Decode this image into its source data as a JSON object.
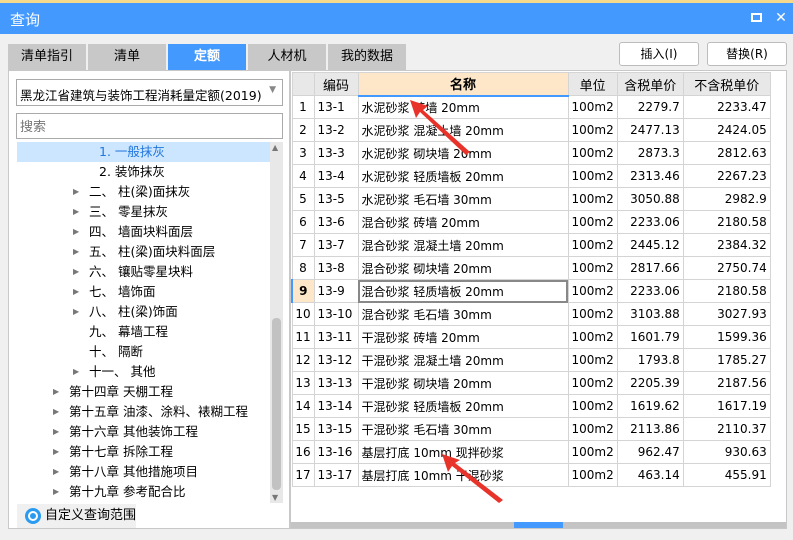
{
  "window": {
    "title": "查询",
    "maximize_icon": "maximize-icon",
    "close_icon": "close-icon"
  },
  "tabs": [
    {
      "label": "清单指引"
    },
    {
      "label": "清单"
    },
    {
      "label": "定额",
      "active": true
    },
    {
      "label": "人材机"
    },
    {
      "label": "我的数据"
    }
  ],
  "buttons": {
    "insert": "插入(I)",
    "replace": "替换(R)"
  },
  "left": {
    "dropdown_value": "黑龙江省建筑与装饰工程消耗量定额(2019)",
    "search_placeholder": "搜索",
    "tree": [
      {
        "label": "1. 一般抹灰",
        "level": 3,
        "selected": true,
        "expandable": false
      },
      {
        "label": "2. 装饰抹灰",
        "level": 3,
        "expandable": false
      },
      {
        "label": "二、 柱(梁)面抹灰",
        "level": 2,
        "expandable": true
      },
      {
        "label": "三、 零星抹灰",
        "level": 2,
        "expandable": true
      },
      {
        "label": "四、 墙面块料面层",
        "level": 2,
        "expandable": true
      },
      {
        "label": "五、 柱(梁)面块料面层",
        "level": 2,
        "expandable": true
      },
      {
        "label": "六、 镶贴零星块料",
        "level": 2,
        "expandable": true
      },
      {
        "label": "七、 墙饰面",
        "level": 2,
        "expandable": true
      },
      {
        "label": "八、 柱(梁)饰面",
        "level": 2,
        "expandable": true
      },
      {
        "label": "九、 幕墙工程",
        "level": 2,
        "expandable": false
      },
      {
        "label": "十、 隔断",
        "level": 2,
        "expandable": false
      },
      {
        "label": "十一、 其他",
        "level": 2,
        "expandable": true
      },
      {
        "label": "第十四章 天棚工程",
        "level": 1,
        "expandable": true
      },
      {
        "label": "第十五章 油漆、涂料、裱糊工程",
        "level": 1,
        "expandable": true
      },
      {
        "label": "第十六章 其他装饰工程",
        "level": 1,
        "expandable": true
      },
      {
        "label": "第十七章 拆除工程",
        "level": 1,
        "expandable": true
      },
      {
        "label": "第十八章 其他措施项目",
        "level": 1,
        "expandable": true
      },
      {
        "label": "第十九章 参考配合比",
        "level": 1,
        "expandable": true
      }
    ],
    "custom_scope": "自定义查询范围"
  },
  "table": {
    "headers": [
      "",
      "编码",
      "名称",
      "单位",
      "含税单价",
      "不含税单价"
    ],
    "selected_row": 9,
    "rows": [
      [
        "1",
        "13-1",
        "水泥砂浆 砖墙 20mm",
        "100m2",
        "2279.7",
        "2233.47"
      ],
      [
        "2",
        "13-2",
        "水泥砂浆 混凝土墙 20mm",
        "100m2",
        "2477.13",
        "2424.05"
      ],
      [
        "3",
        "13-3",
        "水泥砂浆 砌块墙 20mm",
        "100m2",
        "2873.3",
        "2812.63"
      ],
      [
        "4",
        "13-4",
        "水泥砂浆 轻质墙板 20mm",
        "100m2",
        "2313.46",
        "2267.23"
      ],
      [
        "5",
        "13-5",
        "水泥砂浆 毛石墙 30mm",
        "100m2",
        "3050.88",
        "2982.9"
      ],
      [
        "6",
        "13-6",
        "混合砂浆 砖墙 20mm",
        "100m2",
        "2233.06",
        "2180.58"
      ],
      [
        "7",
        "13-7",
        "混合砂浆 混凝土墙 20mm",
        "100m2",
        "2445.12",
        "2384.32"
      ],
      [
        "8",
        "13-8",
        "混合砂浆 砌块墙 20mm",
        "100m2",
        "2817.66",
        "2750.74"
      ],
      [
        "9",
        "13-9",
        "混合砂浆 轻质墙板 20mm",
        "100m2",
        "2233.06",
        "2180.58"
      ],
      [
        "10",
        "13-10",
        "混合砂浆 毛石墙 30mm",
        "100m2",
        "3103.88",
        "3027.93"
      ],
      [
        "11",
        "13-11",
        "干混砂浆 砖墙 20mm",
        "100m2",
        "1601.79",
        "1599.36"
      ],
      [
        "12",
        "13-12",
        "干混砂浆 混凝土墙 20mm",
        "100m2",
        "1793.8",
        "1785.27"
      ],
      [
        "13",
        "13-13",
        "干混砂浆 砌块墙 20mm",
        "100m2",
        "2205.39",
        "2187.56"
      ],
      [
        "14",
        "13-14",
        "干混砂浆 轻质墙板 20mm",
        "100m2",
        "1619.62",
        "1617.19"
      ],
      [
        "15",
        "13-15",
        "干混砂浆 毛石墙 30mm",
        "100m2",
        "2113.86",
        "2110.37"
      ],
      [
        "16",
        "13-16",
        "基层打底 10mm 现拌砂浆",
        "100m2",
        "962.47",
        "930.63"
      ],
      [
        "17",
        "13-17",
        "基层打底 10mm 干混砂浆",
        "100m2",
        "463.14",
        "455.91"
      ]
    ]
  },
  "colors": {
    "accent": "#4499ff",
    "header_highlight": "#fde7c8",
    "annotation_arrow": "#e8332a"
  }
}
